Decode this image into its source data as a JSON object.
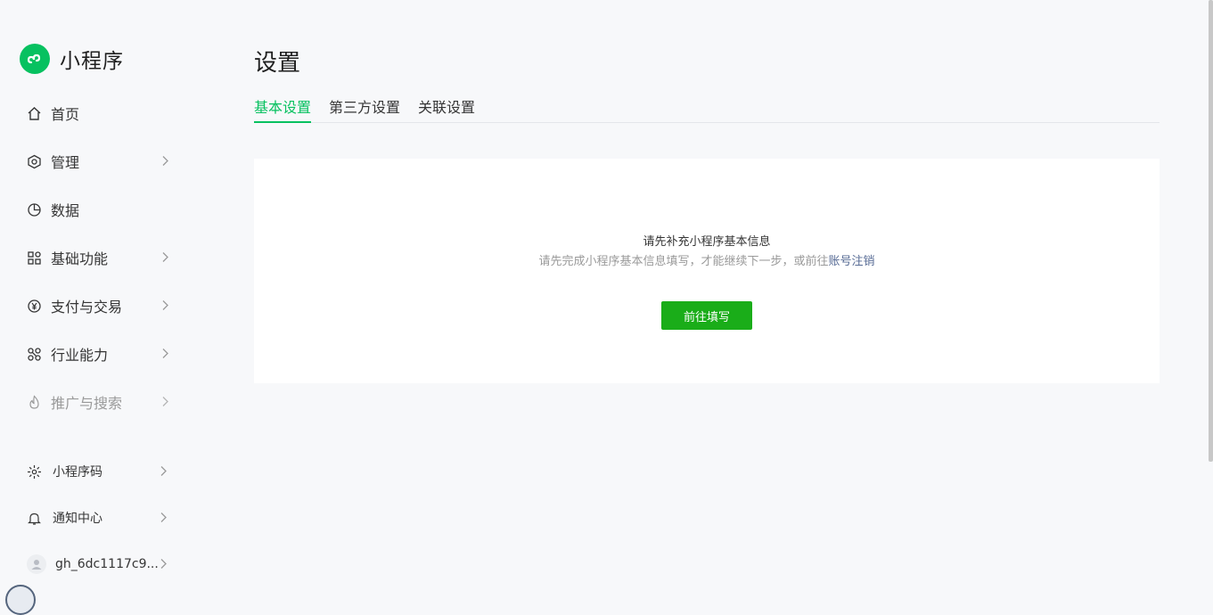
{
  "app": {
    "brand_name": "小程序",
    "accent_color": "#07c160",
    "button_color": "#1aad19",
    "link_color": "#576b95"
  },
  "sidebar": {
    "items": [
      {
        "label": "首页",
        "icon": "home-icon",
        "has_arrow": false
      },
      {
        "label": "管理",
        "icon": "hexagon-settings-icon",
        "has_arrow": true
      },
      {
        "label": "数据",
        "icon": "pie-chart-icon",
        "has_arrow": false
      },
      {
        "label": "基础功能",
        "icon": "grid-icon",
        "has_arrow": true
      },
      {
        "label": "支付与交易",
        "icon": "yen-icon",
        "has_arrow": true
      },
      {
        "label": "行业能力",
        "icon": "nodes-icon",
        "has_arrow": true
      },
      {
        "label": "推广与搜索",
        "icon": "flame-icon",
        "has_arrow": true,
        "disabled": true
      }
    ],
    "utility": [
      {
        "label": "小程序码",
        "icon": "sun-burst-icon"
      },
      {
        "label": "通知中心",
        "icon": "bell-icon"
      },
      {
        "label": "gh_6dc1117c9...",
        "icon": "user-avatar-icon"
      }
    ]
  },
  "main": {
    "title": "设置",
    "tabs": [
      {
        "label": "基本设置",
        "active": true
      },
      {
        "label": "第三方设置",
        "active": false
      },
      {
        "label": "关联设置",
        "active": false
      }
    ],
    "notice": {
      "title": "请先补充小程序基本信息",
      "desc_prefix": "请先完成小程序基本信息填写，才能继续下一步，或前往",
      "desc_link": "账号注销",
      "button": "前往填写"
    }
  }
}
